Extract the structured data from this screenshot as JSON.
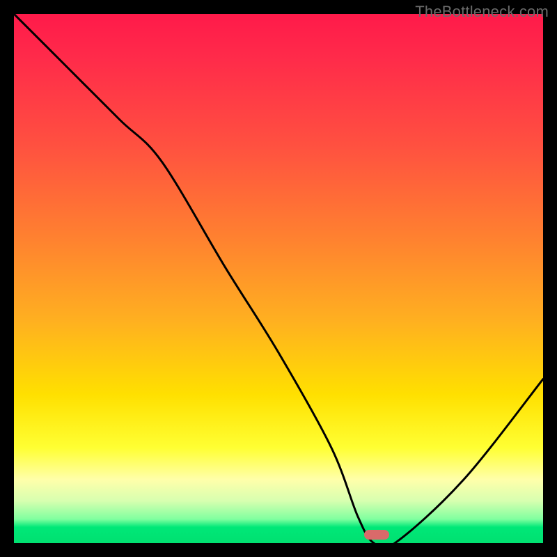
{
  "watermark": "TheBottleneck.com",
  "chart_data": {
    "type": "line",
    "title": "",
    "xlabel": "",
    "ylabel": "",
    "xlim": [
      0,
      100
    ],
    "ylim": [
      0,
      100
    ],
    "grid": false,
    "legend": false,
    "background_gradient_semantics": "red-high to green-low (bottleneck severity)",
    "x": [
      0,
      10,
      20,
      28,
      40,
      50,
      60,
      65,
      68,
      72,
      85,
      100
    ],
    "values": [
      100,
      90,
      80,
      72,
      52,
      36,
      18,
      5,
      0,
      0,
      12,
      31
    ],
    "marker": {
      "x_fraction": 0.685,
      "y_fraction": 0.99,
      "semantics": "optimal-point"
    }
  }
}
